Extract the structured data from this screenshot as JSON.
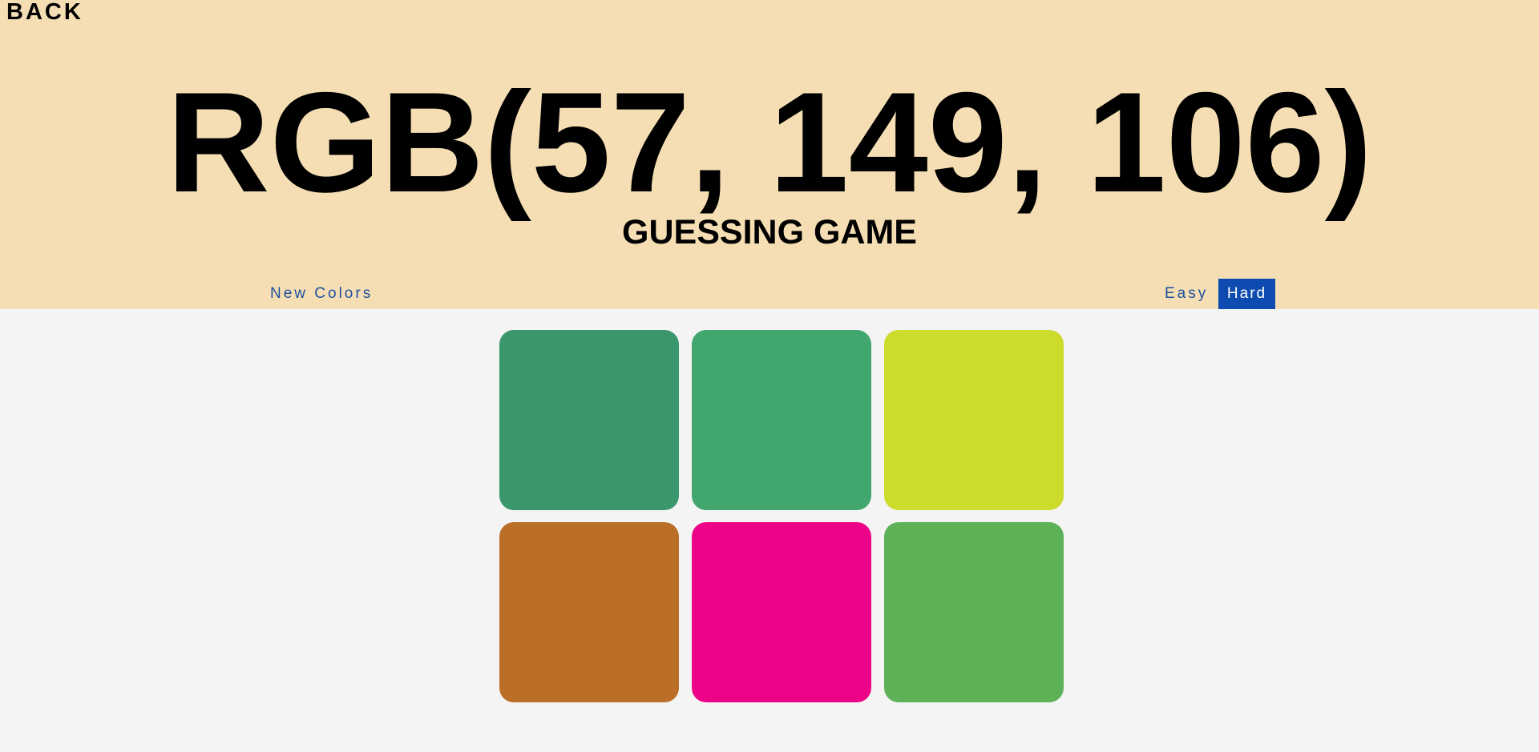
{
  "header": {
    "back_label": "BACK",
    "rgb_display": "RGB(57, 149, 106)",
    "subtitle": "GUESSING GAME",
    "background_color": "#f5deb3"
  },
  "toolbar": {
    "new_colors_label": "New Colors",
    "easy_label": "Easy",
    "hard_label": "Hard",
    "selected_mode": "Hard",
    "accent_color": "#0d4bb0"
  },
  "board": {
    "squares": [
      {
        "color": "#3a976b"
      },
      {
        "color": "#42a66f"
      },
      {
        "color": "#ccdb2c"
      },
      {
        "color": "#bb6e27"
      },
      {
        "color": "#ec0388"
      },
      {
        "color": "#5db257"
      }
    ]
  }
}
